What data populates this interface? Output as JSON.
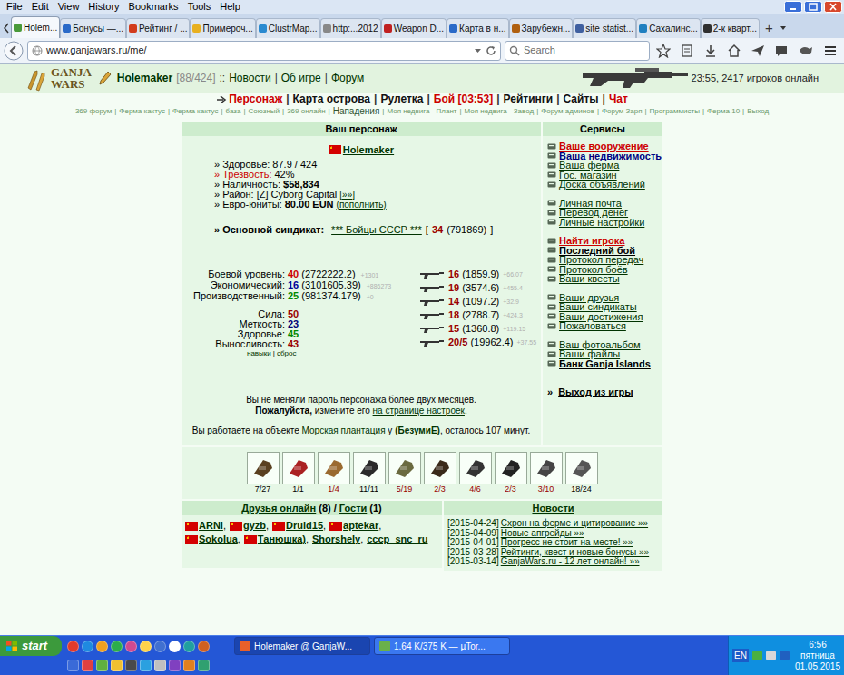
{
  "menu": [
    "File",
    "Edit",
    "View",
    "History",
    "Bookmarks",
    "Tools",
    "Help"
  ],
  "tabs": [
    {
      "label": "Holem...",
      "selected": true
    },
    {
      "label": "Бонусы —...",
      "selected": false
    },
    {
      "label": "Рейтинг / ...",
      "selected": false
    },
    {
      "label": "Примероч...",
      "selected": false
    },
    {
      "label": "ClustrMap...",
      "selected": false
    },
    {
      "label": "http:...2012",
      "selected": false
    },
    {
      "label": "Weapon D...",
      "selected": false
    },
    {
      "label": "Карта в н...",
      "selected": false
    },
    {
      "label": "Зарубежн...",
      "selected": false
    },
    {
      "label": "site statist...",
      "selected": false
    },
    {
      "label": "Сахалинс...",
      "selected": false
    },
    {
      "label": "2-к кварт...",
      "selected": false
    }
  ],
  "new_tab": "+",
  "address": {
    "url": "www.ganjawars.ru/me/"
  },
  "search": {
    "placeholder": "Search"
  },
  "header": {
    "logo": [
      "GANJA",
      "WARS"
    ],
    "user": "Holemaker",
    "hp": "[88/424]",
    "sep": "::",
    "links": [
      "Новости",
      "Об игре",
      "Форум"
    ],
    "link_sep": "|",
    "online": "23:55, 2417 игроков онлайн"
  },
  "nav": {
    "sep": "|",
    "items": [
      {
        "label": "Персонаж",
        "selected": true,
        "alert": false
      },
      {
        "label": "Карта острова",
        "selected": false,
        "alert": false
      },
      {
        "label": "Рулетка",
        "selected": false,
        "alert": false
      },
      {
        "label": "Бой [03:53]",
        "selected": false,
        "alert": true
      },
      {
        "label": "Рейтинги",
        "selected": false,
        "alert": false
      },
      {
        "label": "Сайты",
        "selected": false,
        "alert": false
      },
      {
        "label": "Чат",
        "selected": false,
        "alert": true
      }
    ]
  },
  "bookmarks": {
    "sep": "|",
    "items": [
      {
        "label": "369 форум",
        "bold": false
      },
      {
        "label": "Ферма кактус",
        "bold": false
      },
      {
        "label": "Ферма кактус",
        "bold": false
      },
      {
        "label": "база",
        "bold": false
      },
      {
        "label": "Союзный",
        "bold": false
      },
      {
        "label": "369 онлайн",
        "bold": false
      },
      {
        "label": "Нападения",
        "bold": true
      },
      {
        "label": "Моя недвига - Плант",
        "bold": false
      },
      {
        "label": "Моя недвига - Завод",
        "bold": false
      },
      {
        "label": "Форум админов",
        "bold": false
      },
      {
        "label": "Форум Заря",
        "bold": false
      },
      {
        "label": "Программисты",
        "bold": false
      },
      {
        "label": "Ферма 10",
        "bold": false
      },
      {
        "label": "Выход",
        "bold": false
      }
    ]
  },
  "character": {
    "title": "Ваш персонаж",
    "name": "Holemaker",
    "stats": [
      {
        "kind": "plain",
        "label": "» Здоровье:",
        "value": "87.9 / 424"
      },
      {
        "kind": "alert",
        "label": "» Трезвость:",
        "value": "42%"
      },
      {
        "kind": "money",
        "label": "» Наличность:",
        "value": "$58,834"
      },
      {
        "kind": "link",
        "label": "» Район:",
        "value": "[Z] Cyborg Capital",
        "link": "[»»]"
      },
      {
        "kind": "currency",
        "label": "» Евро-юниты:",
        "value": "80.00 EUN",
        "link": "(пополнить)"
      }
    ],
    "syndicate": {
      "label": "» Основной синдикат:",
      "name": "*** Бойцы СССР ***",
      "open": "[",
      "number": "34",
      "points": "(791869)",
      "close": "]"
    },
    "levels": [
      {
        "label": "Боевой уровень:",
        "level": "40",
        "exp": "(2722222.2)",
        "delta": "+1301",
        "color": "#cc0000"
      },
      {
        "label": "Экономический:",
        "level": "16",
        "exp": "(3101605.39)",
        "delta": "+886273",
        "color": "#000099"
      },
      {
        "label": "Производственный:",
        "level": "25",
        "exp": "(981374.179)",
        "delta": "+0",
        "color": "#008800"
      }
    ],
    "attributes": [
      {
        "label": "Сила:",
        "value": "50",
        "color": "#990000"
      },
      {
        "label": "Меткость:",
        "value": "23",
        "color": "#000077"
      },
      {
        "label": "Здоровье:",
        "value": "45",
        "color": "#008800"
      },
      {
        "label": "Выносливость:",
        "value": "43",
        "color": "#990000"
      }
    ],
    "skill_links": {
      "items": [
        "навыки",
        "сброс"
      ],
      "sep": "|"
    },
    "weapons": [
      {
        "level": "16",
        "exp": "(1859.9)",
        "delta": "+66.07"
      },
      {
        "level": "19",
        "exp": "(3574.6)",
        "delta": "+455.4"
      },
      {
        "level": "14",
        "exp": "(1097.2)",
        "delta": "+32.9"
      },
      {
        "level": "18",
        "exp": "(2788.7)",
        "delta": "+424.3"
      },
      {
        "level": "15",
        "exp": "(1360.8)",
        "delta": "+119.15"
      },
      {
        "level": "20/5",
        "exp": "(19962.4)",
        "delta": "+37.55"
      }
    ],
    "password_notice": {
      "line1": "Вы не меняли пароль персонажа более двух месяцев.",
      "please": "Пожалуйста,",
      "text": " измените его ",
      "link": "на странице настроек",
      "end": "."
    },
    "work_notice": {
      "text1": "Вы работаете на объекте ",
      "object": "Морская плантация",
      "text2": " у ",
      "owner": "(БезумиЕ)",
      "text3": ", осталось 107 минут."
    }
  },
  "services": {
    "title": "Сервисы",
    "groups": [
      [
        {
          "label": "Ваше вооружение",
          "bold": true,
          "color": "#cc0000"
        },
        {
          "label": "Ваша недвижимость",
          "bold": true,
          "color": "#000080"
        },
        {
          "label": "Ваша ферма",
          "bold": false,
          "color": "#003300"
        },
        {
          "label": "Гос. магазин",
          "bold": false,
          "color": "#003300"
        },
        {
          "label": "Доска объявлений",
          "bold": false,
          "color": "#003300"
        }
      ],
      [
        {
          "label": "Личная почта",
          "bold": false,
          "color": "#003300"
        },
        {
          "label": "Перевод денег",
          "bold": false,
          "color": "#003300"
        },
        {
          "label": "Личные настройки",
          "bold": false,
          "color": "#003300"
        }
      ],
      [
        {
          "label": "Найти игрока",
          "bold": true,
          "color": "#cc0000"
        },
        {
          "label": "Последний бой",
          "bold": true,
          "color": "#000000"
        },
        {
          "label": "Протокол передач",
          "bold": false,
          "color": "#003300"
        },
        {
          "label": "Протокол боёв",
          "bold": false,
          "color": "#003300"
        },
        {
          "label": "Ваши квесты",
          "bold": false,
          "color": "#003300"
        }
      ],
      [
        {
          "label": "Ваши друзья",
          "bold": false,
          "color": "#003300"
        },
        {
          "label": "Ваши синдикаты",
          "bold": false,
          "color": "#003300"
        },
        {
          "label": "Ваши достижения",
          "bold": false,
          "color": "#003300"
        },
        {
          "label": "Пожаловаться",
          "bold": false,
          "color": "#003300"
        }
      ],
      [
        {
          "label": "Ваш фотоальбом",
          "bold": false,
          "color": "#003300"
        },
        {
          "label": "Ваши файлы",
          "bold": false,
          "color": "#003300"
        },
        {
          "label": "Банк Ganja Islands",
          "bold": true,
          "color": "#000000"
        }
      ]
    ],
    "exit": {
      "arrow": "»",
      "label": "Выход из игры"
    }
  },
  "items": [
    {
      "count": "7/27",
      "color": "#000000"
    },
    {
      "count": "1/1",
      "color": "#000000"
    },
    {
      "count": "1/4",
      "color": "#990000"
    },
    {
      "count": "11/11",
      "color": "#000000"
    },
    {
      "count": "5/19",
      "color": "#990000"
    },
    {
      "count": "2/3",
      "color": "#990000"
    },
    {
      "count": "4/6",
      "color": "#990000"
    },
    {
      "count": "2/3",
      "color": "#990000"
    },
    {
      "count": "3/10",
      "color": "#990000"
    },
    {
      "count": "18/24",
      "color": "#000000"
    }
  ],
  "friends": {
    "title": "Друзья онлайн",
    "count": "(8)",
    "sep": "/",
    "guests": "Гости",
    "guests_count": "(1)",
    "name_sep": ",",
    "list": [
      {
        "name": "ARNI",
        "flag": true
      },
      {
        "name": "gyzb",
        "flag": true
      },
      {
        "name": "Druid15",
        "flag": true
      },
      {
        "name": "aptekar",
        "flag": true
      },
      {
        "name": "Sokolua",
        "flag": true
      },
      {
        "name": "Танюшка)",
        "flag": true
      },
      {
        "name": "Shorshely",
        "flag": false
      },
      {
        "name": "cccp_snc_ru",
        "flag": false
      }
    ]
  },
  "news": {
    "title": "Новости",
    "items": [
      {
        "date": "[2015-04-24]",
        "text": "Схрон на ферме и цитирование »»"
      },
      {
        "date": "[2015-04-09]",
        "text": "Новые апгрейды »»"
      },
      {
        "date": "[2015-04-01]",
        "text": "Прогресс не стоит на месте! »»"
      },
      {
        "date": "[2015-03-28]",
        "text": "Рейтинги, квест и новые бонусы »»"
      },
      {
        "date": "[2015-03-14]",
        "text": "GanjaWars.ru - 12 лет онлайн! »»"
      }
    ]
  },
  "taskbar": {
    "start": "start",
    "tasks": [
      {
        "label": "Holemaker @ GanjaW...",
        "selected": true
      },
      {
        "label": "1.64 K/375 K — µTor...",
        "selected": false
      }
    ],
    "lang": "EN",
    "time": "6:56",
    "day": "пятница",
    "date": "01.05.2015"
  }
}
